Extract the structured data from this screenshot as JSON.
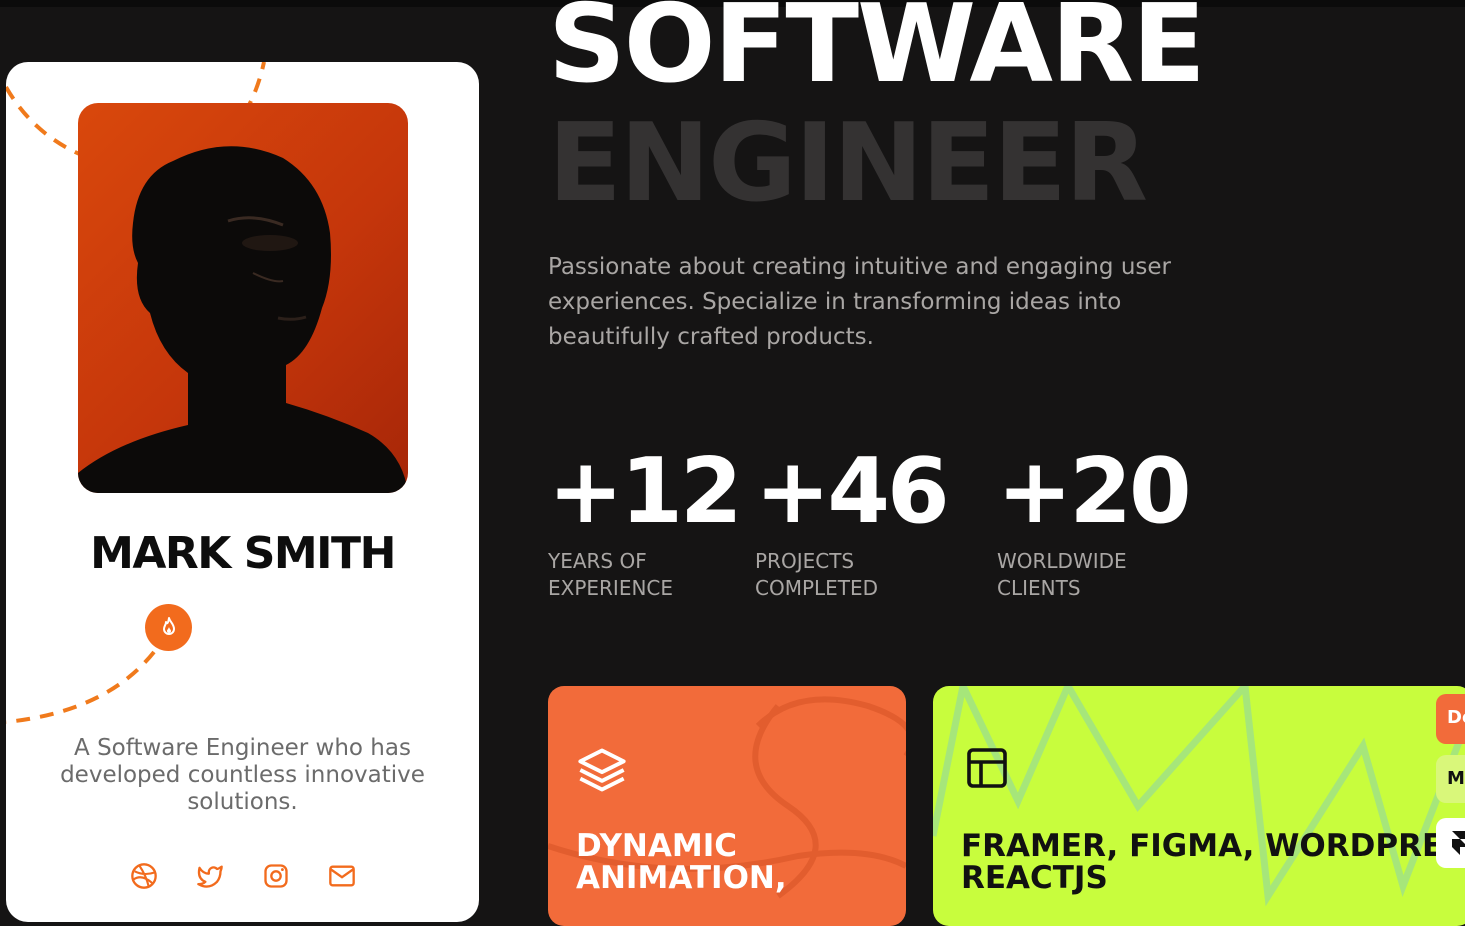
{
  "profile": {
    "name": "MARK SMITH",
    "bio": "A Software Engineer who has developed countless innovative solutions.",
    "portrait_alt": "portrait photo",
    "socials": [
      "dribbble-icon",
      "twitter-icon",
      "instagram-icon",
      "mail-icon"
    ]
  },
  "hero": {
    "title_line1": "SOFTWARE",
    "title_line2": "ENGINEER",
    "intro": "Passionate about creating intuitive and engaging user experiences. Specialize in transforming ideas into beautifully crafted products."
  },
  "stats": [
    {
      "value": "+12",
      "label_line1": "YEARS OF",
      "label_line2": "EXPERIENCE"
    },
    {
      "value": "+46",
      "label_line1": "PROJECTS",
      "label_line2": "COMPLETED"
    },
    {
      "value": "+20",
      "label_line1": "WORLDWIDE",
      "label_line2": "CLIENTS"
    }
  ],
  "features": [
    {
      "title_line1": "DYNAMIC",
      "title_line2": "ANIMATION,",
      "icon": "layers-icon"
    },
    {
      "title_line1": "FRAMER, FIGMA, WORDPRESS,",
      "title_line2": "REACTJS",
      "icon": "layout-icon"
    }
  ],
  "edge_tabs": [
    {
      "label": "De"
    },
    {
      "label": "M"
    },
    {
      "label": ""
    }
  ],
  "colors": {
    "background": "#151414",
    "accent_orange": "#f26b3a",
    "accent_lime": "#c8fd3d",
    "card": "#ffffff"
  }
}
